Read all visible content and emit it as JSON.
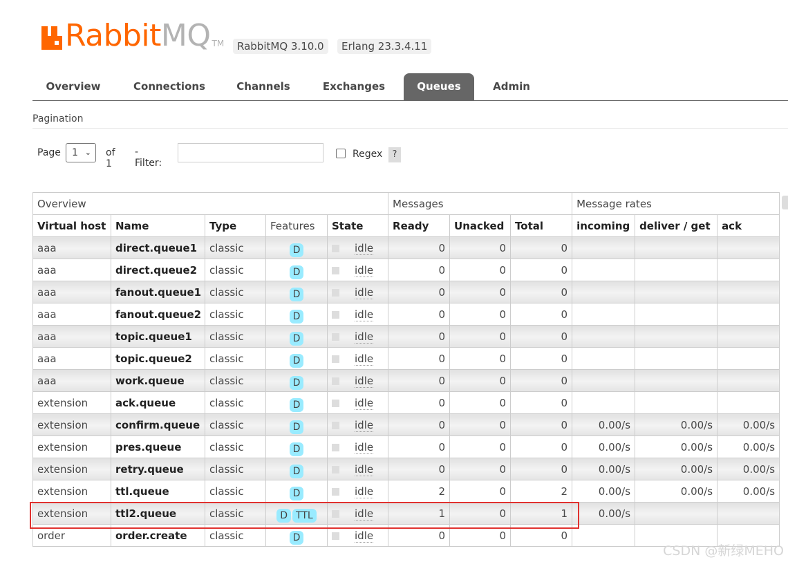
{
  "header": {
    "logo_rabbit": "Rabbit",
    "logo_mq": "MQ",
    "logo_tm": "TM",
    "version": "RabbitMQ 3.10.0",
    "erlang": "Erlang 23.3.4.11"
  },
  "tabs": [
    "Overview",
    "Connections",
    "Channels",
    "Exchanges",
    "Queues",
    "Admin"
  ],
  "active_tab": "Queues",
  "section_title": "Pagination",
  "pagination": {
    "page_label": "Page",
    "page_value": "1",
    "of_label": "of 1",
    "filter_label": "- Filter:",
    "filter_value": "",
    "regex_label": "Regex",
    "help": "?"
  },
  "table": {
    "group_headers": [
      "Overview",
      "Messages",
      "Message rates"
    ],
    "columns": [
      "Virtual host",
      "Name",
      "Type",
      "Features",
      "State",
      "Ready",
      "Unacked",
      "Total",
      "incoming",
      "deliver / get",
      "ack"
    ],
    "rows": [
      {
        "vhost": "aaa",
        "name": "direct.queue1",
        "type": "classic",
        "features": [
          "D"
        ],
        "state": "idle",
        "ready": "0",
        "unacked": "0",
        "total": "0",
        "incoming": "",
        "deliver": "",
        "ack": ""
      },
      {
        "vhost": "aaa",
        "name": "direct.queue2",
        "type": "classic",
        "features": [
          "D"
        ],
        "state": "idle",
        "ready": "0",
        "unacked": "0",
        "total": "0",
        "incoming": "",
        "deliver": "",
        "ack": ""
      },
      {
        "vhost": "aaa",
        "name": "fanout.queue1",
        "type": "classic",
        "features": [
          "D"
        ],
        "state": "idle",
        "ready": "0",
        "unacked": "0",
        "total": "0",
        "incoming": "",
        "deliver": "",
        "ack": ""
      },
      {
        "vhost": "aaa",
        "name": "fanout.queue2",
        "type": "classic",
        "features": [
          "D"
        ],
        "state": "idle",
        "ready": "0",
        "unacked": "0",
        "total": "0",
        "incoming": "",
        "deliver": "",
        "ack": ""
      },
      {
        "vhost": "aaa",
        "name": "topic.queue1",
        "type": "classic",
        "features": [
          "D"
        ],
        "state": "idle",
        "ready": "0",
        "unacked": "0",
        "total": "0",
        "incoming": "",
        "deliver": "",
        "ack": ""
      },
      {
        "vhost": "aaa",
        "name": "topic.queue2",
        "type": "classic",
        "features": [
          "D"
        ],
        "state": "idle",
        "ready": "0",
        "unacked": "0",
        "total": "0",
        "incoming": "",
        "deliver": "",
        "ack": ""
      },
      {
        "vhost": "aaa",
        "name": "work.queue",
        "type": "classic",
        "features": [
          "D"
        ],
        "state": "idle",
        "ready": "0",
        "unacked": "0",
        "total": "0",
        "incoming": "",
        "deliver": "",
        "ack": ""
      },
      {
        "vhost": "extension",
        "name": "ack.queue",
        "type": "classic",
        "features": [
          "D"
        ],
        "state": "idle",
        "ready": "0",
        "unacked": "0",
        "total": "0",
        "incoming": "",
        "deliver": "",
        "ack": ""
      },
      {
        "vhost": "extension",
        "name": "confirm.queue",
        "type": "classic",
        "features": [
          "D"
        ],
        "state": "idle",
        "ready": "0",
        "unacked": "0",
        "total": "0",
        "incoming": "0.00/s",
        "deliver": "0.00/s",
        "ack": "0.00/s"
      },
      {
        "vhost": "extension",
        "name": "pres.queue",
        "type": "classic",
        "features": [
          "D"
        ],
        "state": "idle",
        "ready": "0",
        "unacked": "0",
        "total": "0",
        "incoming": "0.00/s",
        "deliver": "0.00/s",
        "ack": "0.00/s"
      },
      {
        "vhost": "extension",
        "name": "retry.queue",
        "type": "classic",
        "features": [
          "D"
        ],
        "state": "idle",
        "ready": "0",
        "unacked": "0",
        "total": "0",
        "incoming": "0.00/s",
        "deliver": "0.00/s",
        "ack": "0.00/s"
      },
      {
        "vhost": "extension",
        "name": "ttl.queue",
        "type": "classic",
        "features": [
          "D"
        ],
        "state": "idle",
        "ready": "2",
        "unacked": "0",
        "total": "2",
        "incoming": "0.00/s",
        "deliver": "0.00/s",
        "ack": "0.00/s"
      },
      {
        "vhost": "extension",
        "name": "ttl2.queue",
        "type": "classic",
        "features": [
          "D",
          "TTL"
        ],
        "state": "idle",
        "ready": "1",
        "unacked": "0",
        "total": "1",
        "incoming": "0.00/s",
        "deliver": "",
        "ack": ""
      },
      {
        "vhost": "order",
        "name": "order.create",
        "type": "classic",
        "features": [
          "D"
        ],
        "state": "idle",
        "ready": "0",
        "unacked": "0",
        "total": "0",
        "incoming": "",
        "deliver": "",
        "ack": ""
      }
    ]
  },
  "watermark": "CSDN @新绿MEHO",
  "colors": {
    "brand": "#ff6600",
    "tab_active": "#666666",
    "feature_tag": "#99ebff",
    "highlight": "#e0322f"
  }
}
